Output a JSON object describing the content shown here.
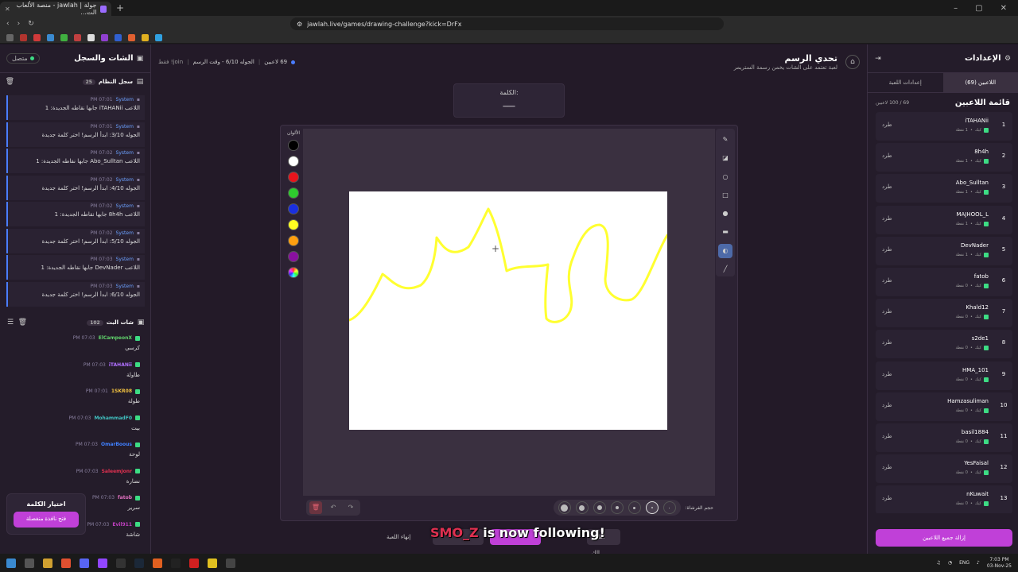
{
  "browser": {
    "tab_title": "جولة | jawlah - منصة الألعاب الت...",
    "url": "jawlah.live/games/drawing-challenge?kick=DrFx"
  },
  "left": {
    "title": "الشات والسجل",
    "status": "متصل",
    "syslog_title": "سجل النظام",
    "syslog_count": "25",
    "syslog": [
      {
        "time": "PM 07:01",
        "who": "System",
        "text": "اللاعب iTAHANii جابها نقاطه الجديدة: 1"
      },
      {
        "time": "PM 07:01",
        "who": "System",
        "text": "الجوله 3/10: ابدأ الرسم! اختر كلمة جديدة"
      },
      {
        "time": "PM 07:02",
        "who": "System",
        "text": "اللاعب Abo_Sulltan جابها نقاطه الجديدة: 1"
      },
      {
        "time": "PM 07:02",
        "who": "System",
        "text": "الجوله 4/10: ابدأ الرسم! اختر كلمة جديدة"
      },
      {
        "time": "PM 07:02",
        "who": "System",
        "text": "اللاعب 8h4h جابها نقاطه الجديدة: 1"
      },
      {
        "time": "PM 07:02",
        "who": "System",
        "text": "الجوله 5/10: ابدأ الرسم! اختر كلمة جديدة"
      },
      {
        "time": "PM 07:03",
        "who": "System",
        "text": "اللاعب DevNader جابها نقاطه الجديدة: 1"
      },
      {
        "time": "PM 07:03",
        "who": "System",
        "text": "الجوله 6/10: ابدأ الرسم! اختر كلمة جديدة"
      }
    ],
    "chat_title": "شات البث",
    "chat_count": "102",
    "chat": [
      {
        "user": "ElCampeonX",
        "color": "#5fd06a",
        "time": "PM 07:03",
        "text": "كرسي"
      },
      {
        "user": "iTAHANii",
        "color": "#b070ff",
        "time": "PM 07:03",
        "text": "طاولة"
      },
      {
        "user": "1SKR08",
        "color": "#f0c040",
        "time": "PM 07:01",
        "text": "طولة"
      },
      {
        "user": "MohammadF0",
        "color": "#40c0c0",
        "time": "PM 07:03",
        "text": "بيت"
      },
      {
        "user": "OmarBoous",
        "color": "#4080ff",
        "time": "PM 07:03",
        "text": "لوحة"
      },
      {
        "user": "SaleemJonr",
        "color": "#e03050",
        "time": "PM 07:03",
        "text": "نضارة"
      },
      {
        "user": "fatob",
        "color": "#e070c0",
        "time": "PM 07:03",
        "text": "سرير"
      },
      {
        "user": "Evil911",
        "color": "#c040c0",
        "time": "PM 07:03",
        "text": "شاشة"
      }
    ],
    "pick_title": "اختيار الكلمة",
    "pick_button": "فتح نافذة منفصلة"
  },
  "center": {
    "game_title": "تحدي الرسم",
    "game_subtitle": "لعبة تعتمد على الشات يخمن رسمة الستريمر",
    "players": "69 لاعبين",
    "round": "الجوله 6/10 - وقت الرسم",
    "join": "join! فقط",
    "word_label": "الكلمة:",
    "word_value": "___",
    "colors_label": "الألوان",
    "colors": [
      "#000000",
      "#ffffff",
      "#e8141c",
      "#2ecc2e",
      "#1a2fe0",
      "#ffff22",
      "#ff9f10",
      "#8a10a0"
    ],
    "brush_label": "حجم الفرشاة:",
    "actions": {
      "end": "إنهاء اللعبة",
      "show": "اظهار الك..."
    },
    "overlay_user": "SMO_Z",
    "overlay_text": " is now following!"
  },
  "right": {
    "title": "الإعدادات",
    "tab_players": "اللاعبين (69)",
    "tab_settings": "إعدادات اللعبة",
    "list_title": "قائمة اللاعبين",
    "list_count": "69 / 100 لاعبين",
    "kick_label": "طرد",
    "players": [
      {
        "rank": "1",
        "name": "iTAHANii",
        "pts": "1 نقطة"
      },
      {
        "rank": "2",
        "name": "8h4h",
        "pts": "1 نقطة"
      },
      {
        "rank": "3",
        "name": "Abo_Sulltan",
        "pts": "1 نقطة"
      },
      {
        "rank": "4",
        "name": "MAJHOOL_L",
        "pts": "1 نقطة"
      },
      {
        "rank": "5",
        "name": "DevNader",
        "pts": "1 نقطة"
      },
      {
        "rank": "6",
        "name": "fatob",
        "pts": "0 نقطة"
      },
      {
        "rank": "7",
        "name": "Khald12",
        "pts": "0 نقطة"
      },
      {
        "rank": "8",
        "name": "s2de1",
        "pts": "0 نقطة"
      },
      {
        "rank": "9",
        "name": "HMA_101",
        "pts": "0 نقطة"
      },
      {
        "rank": "10",
        "name": "Hamzasuliman",
        "pts": "0 نقطة"
      },
      {
        "rank": "11",
        "name": "basil1884",
        "pts": "0 نقطة"
      },
      {
        "rank": "12",
        "name": "YesFaisal",
        "pts": "0 نقطة"
      },
      {
        "rank": "13",
        "name": "nKuwait",
        "pts": "0 نقطة"
      }
    ],
    "kick_tag": "كيك",
    "remove_all": "إزالة جميع اللاعبين"
  },
  "taskbar": {
    "lang": "ENG",
    "time": "7:03 PM",
    "date": "03-Nov-25"
  }
}
